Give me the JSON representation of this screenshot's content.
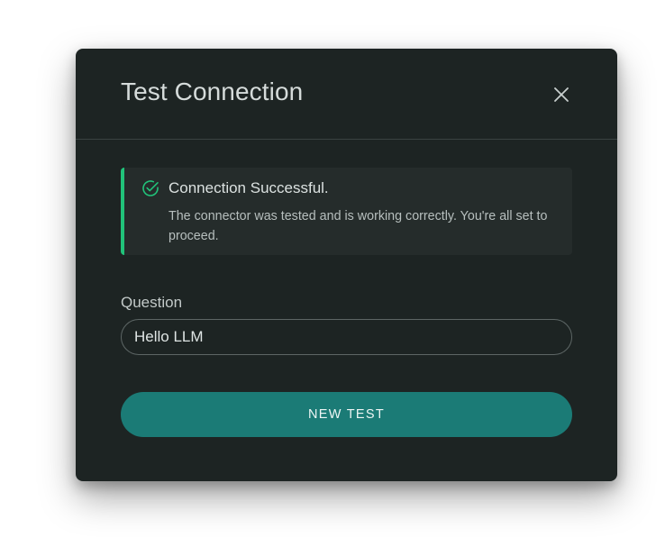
{
  "dialog": {
    "title": "Test Connection",
    "close_icon": "close-icon"
  },
  "alert": {
    "status": "success",
    "icon": "check-circle-icon",
    "accent_color": "#21c37a",
    "title": "Connection Successful.",
    "message": "The connector was tested and is working correctly. You're all set to proceed."
  },
  "form": {
    "question_label": "Question",
    "question_value": "Hello LLM"
  },
  "actions": {
    "new_test_label": "NEW TEST",
    "button_color": "#1b7b76"
  }
}
